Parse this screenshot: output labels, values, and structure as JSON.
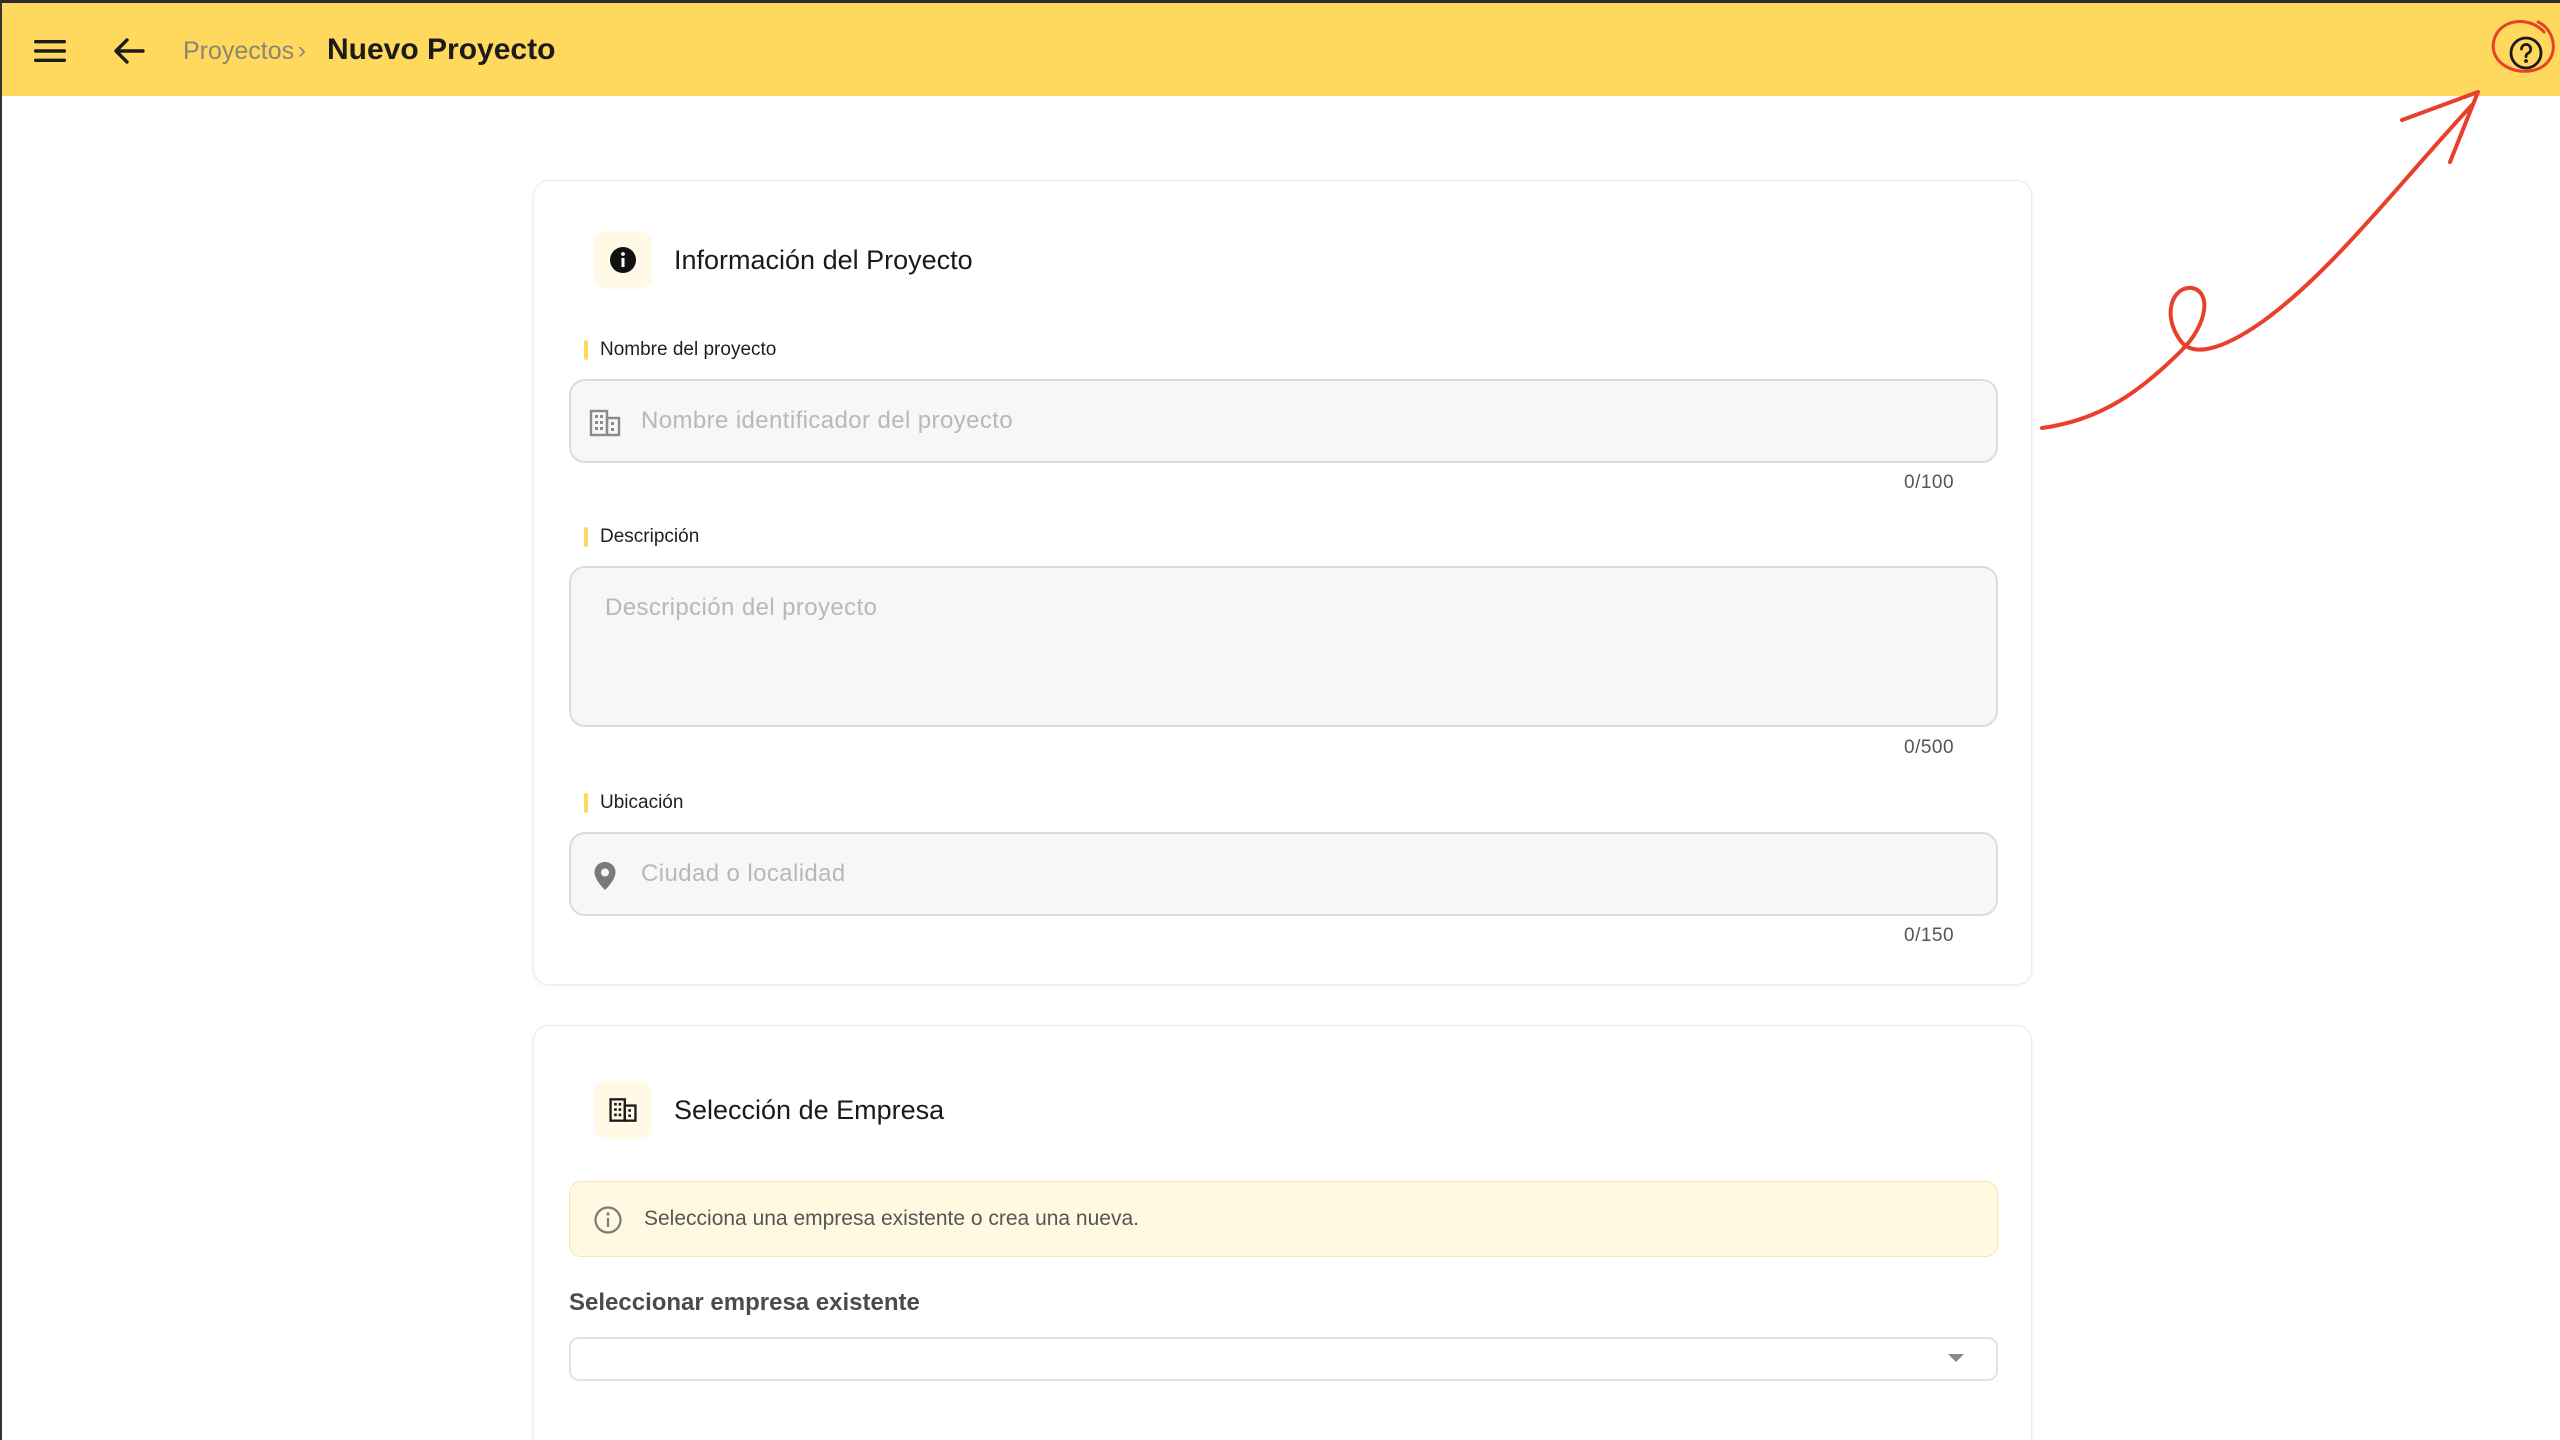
{
  "header": {
    "breadcrumb_parent": "Proyectos",
    "breadcrumb_separator": "›",
    "title": "Nuevo Proyecto",
    "menu_icon": "menu-icon",
    "back_icon": "arrow-back-icon",
    "help_icon": "help-circle-icon"
  },
  "project_info": {
    "title": "Información del Proyecto",
    "icon": "info-icon",
    "name": {
      "label": "Nombre del proyecto",
      "placeholder": "Nombre identificador del proyecto",
      "value": "",
      "counter": "0/100",
      "icon": "building-icon"
    },
    "description": {
      "label": "Descripción",
      "placeholder": "Descripción del proyecto",
      "value": "",
      "counter": "0/500"
    },
    "location": {
      "label": "Ubicación",
      "placeholder": "Ciudad o localidad",
      "value": "",
      "counter": "0/150",
      "icon": "location-pin-icon"
    }
  },
  "company": {
    "title": "Selección de Empresa",
    "icon": "building-icon",
    "info_message": "Selecciona una empresa existente o crea una nueva.",
    "select_label": "Seleccionar empresa existente",
    "select_value": ""
  },
  "colors": {
    "header_bg": "#ffd95e",
    "accent": "#ffd95e",
    "annotation": "#e8402a"
  }
}
